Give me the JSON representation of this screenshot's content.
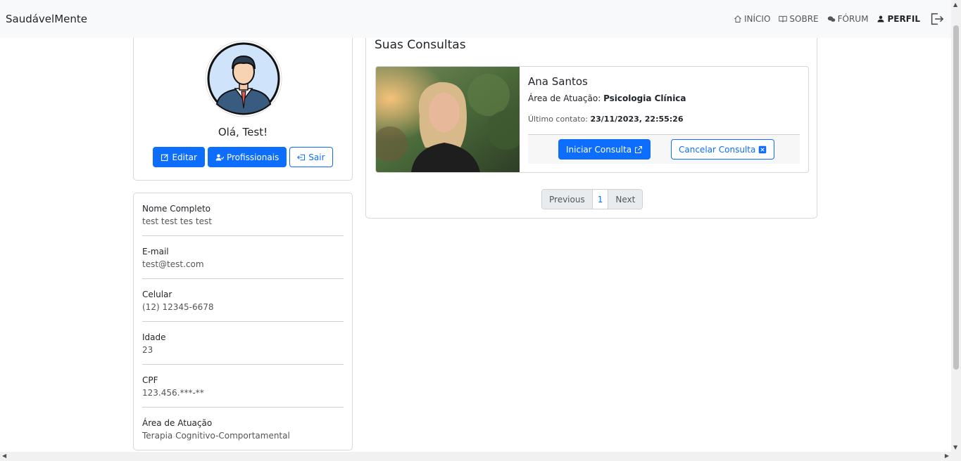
{
  "navbar": {
    "brand": "SaudávelMente",
    "links": [
      {
        "label": "INÍCIO",
        "icon": "house-icon"
      },
      {
        "label": "SOBRE",
        "icon": "book-icon"
      },
      {
        "label": "FÓRUM",
        "icon": "chat-icon"
      },
      {
        "label": "PERFIL",
        "icon": "person-icon"
      }
    ]
  },
  "profile": {
    "greeting": "Olá, Test!",
    "buttons": {
      "edit": "Editar",
      "professionals": "Profissionais",
      "logout": "Sair"
    }
  },
  "info": {
    "items": [
      {
        "label": "Nome Completo",
        "value": "test test tes test"
      },
      {
        "label": "E-mail",
        "value": "test@test.com"
      },
      {
        "label": "Celular",
        "value": "(12) 12345-6678"
      },
      {
        "label": "Idade",
        "value": "23"
      },
      {
        "label": "CPF",
        "value": "123.456.***-**"
      },
      {
        "label": "Área de Atuação",
        "value": "Terapia Cognitivo-Comportamental"
      }
    ]
  },
  "consultas": {
    "title": "Suas Consultas",
    "items": [
      {
        "name": "Ana Santos",
        "area_label": "Área de Atuação:",
        "area": "Psicologia Clínica",
        "contact_label": "Último contato:",
        "contact": "23/11/2023, 22:55:26",
        "start_label": "Iniciar Consulta",
        "cancel_label": "Cancelar Consulta"
      }
    ],
    "pagination": {
      "previous": "Previous",
      "current": "1",
      "next": "Next"
    }
  },
  "colors": {
    "primary": "#0d6efd",
    "navbar_bg": "#f8f9fa"
  }
}
